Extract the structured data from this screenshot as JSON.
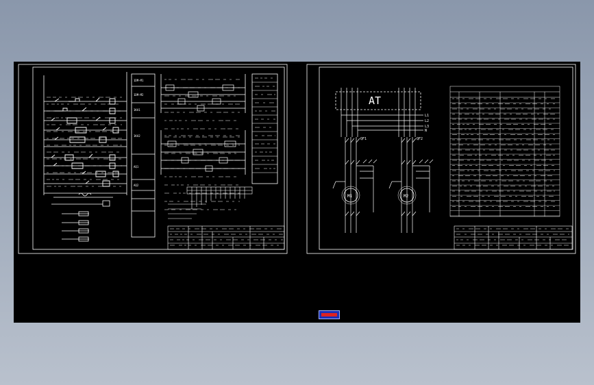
{
  "app": {
    "viewport_label": "CAD drawing viewport",
    "background_color": "#000000",
    "line_color": "#ffffff",
    "nav_widget_colors": {
      "frame": "#1a2fb8",
      "mark": "#dd2222"
    }
  },
  "right_sheet": {
    "transfer_switch_label": "AT",
    "breaker_labels": [
      "QF1",
      "QF2"
    ],
    "motor_labels": [
      "M1",
      "M2"
    ],
    "bus_labels": [
      "L1",
      "L2",
      "L3",
      "N"
    ]
  },
  "left_sheet": {
    "side_notes": [
      "1DM-M1",
      "1DM-M2",
      "1KA1",
      "1KA2",
      "AQ1",
      "AQ2"
    ]
  }
}
